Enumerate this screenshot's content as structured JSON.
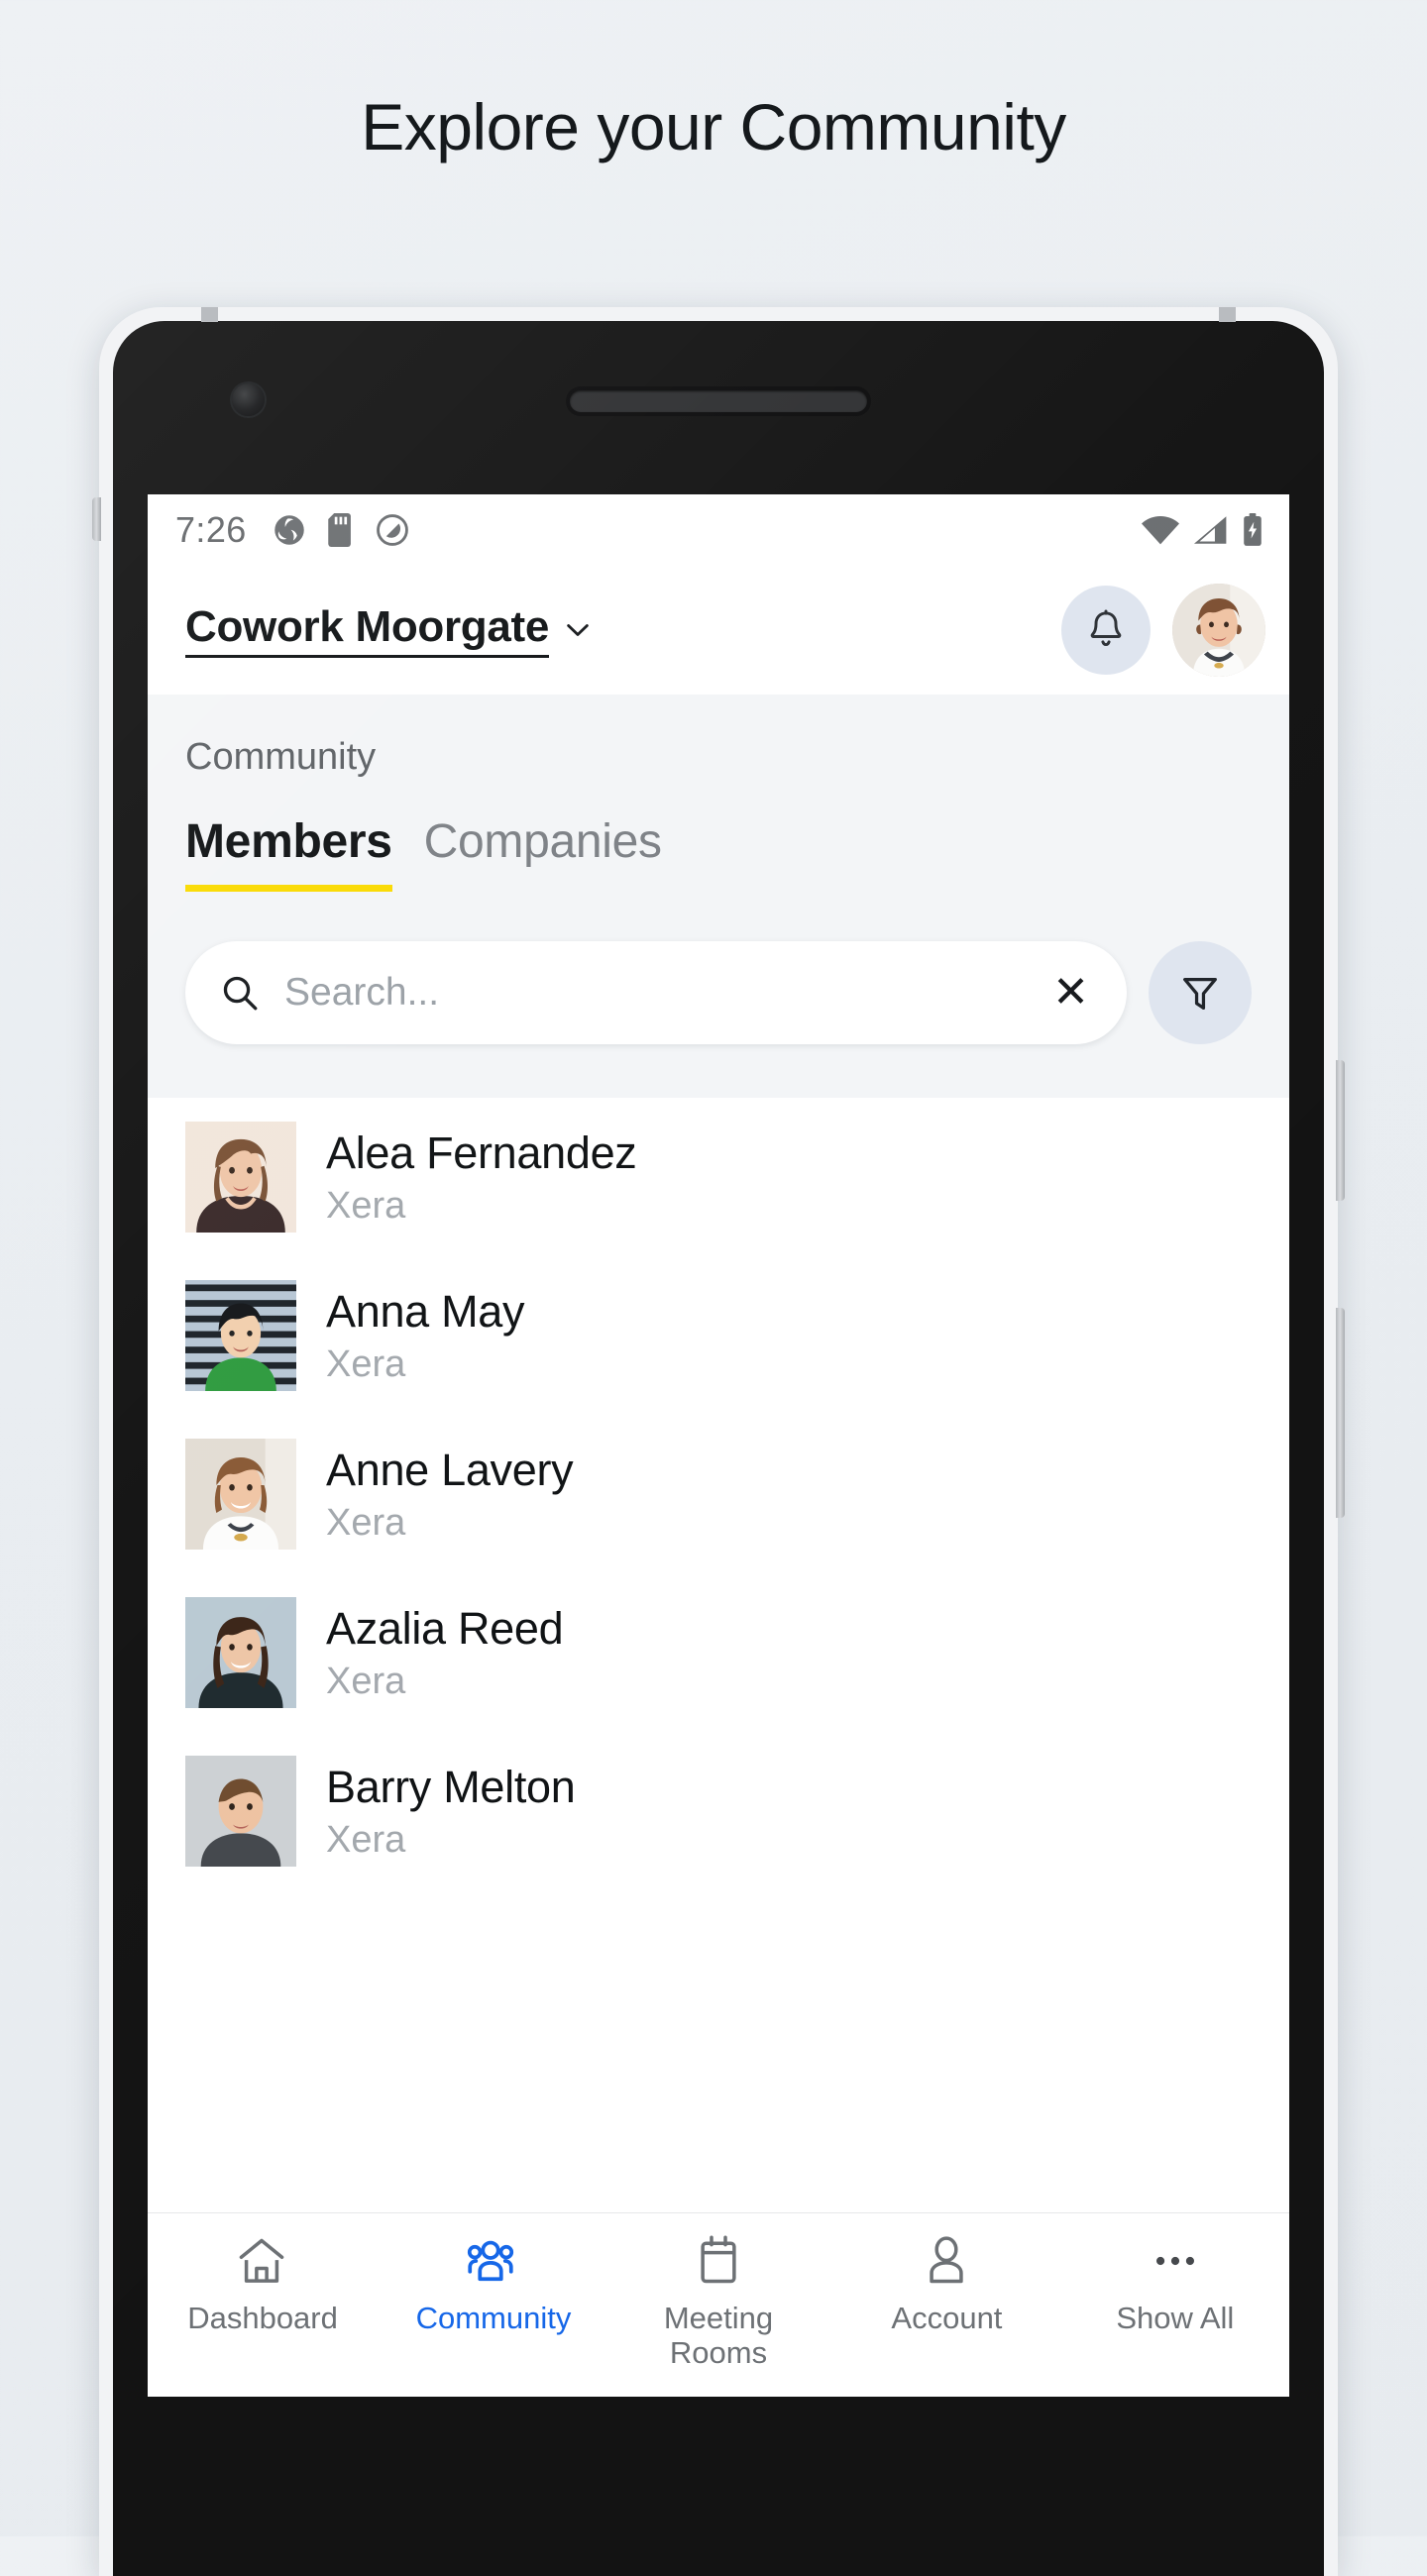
{
  "page": {
    "headline": "Explore your Community"
  },
  "status_bar": {
    "time": "7:26",
    "left_icons": [
      "app-badge-icon",
      "sd-card-icon",
      "do-not-disturb-icon"
    ],
    "right_icons": [
      "wifi-icon",
      "cellular-signal-icon",
      "battery-charging-icon"
    ]
  },
  "app_header": {
    "venue_name": "Cowork Moorgate",
    "venue_chevron": "chevron-down-icon",
    "bell_icon": "notification-bell-icon",
    "avatar": "user-avatar"
  },
  "section": {
    "title": "Community",
    "tabs": [
      {
        "label": "Members",
        "active": true
      },
      {
        "label": "Companies",
        "active": false
      }
    ],
    "accent_color": "#fada00"
  },
  "search": {
    "icon": "search-icon",
    "value": "",
    "placeholder": "Search...",
    "clear_label": "✕",
    "filter_icon": "filter-funnel-icon"
  },
  "members": [
    {
      "name": "Alea Fernandez",
      "company": "Xera"
    },
    {
      "name": "Anna May",
      "company": "Xera"
    },
    {
      "name": "Anne Lavery",
      "company": "Xera"
    },
    {
      "name": "Azalia Reed",
      "company": "Xera"
    },
    {
      "name": "Barry Melton",
      "company": "Xera"
    }
  ],
  "bottom_nav": {
    "active_color": "#1667e8",
    "items": [
      {
        "label": "Dashboard",
        "icon": "home-icon",
        "active": false
      },
      {
        "label": "Community",
        "icon": "people-group-icon",
        "active": true
      },
      {
        "label": "Meeting Rooms",
        "icon": "calendar-icon",
        "active": false
      },
      {
        "label": "Account",
        "icon": "person-icon",
        "active": false
      },
      {
        "label": "Show All",
        "icon": "ellipsis-icon",
        "active": false
      }
    ]
  }
}
